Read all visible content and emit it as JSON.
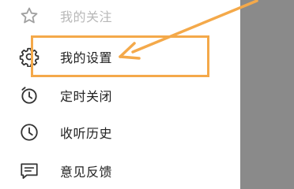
{
  "menu": {
    "items": [
      {
        "label": "我的关注",
        "icon": "star-icon"
      },
      {
        "label": "我的设置",
        "icon": "gear-icon"
      },
      {
        "label": "定时关闭",
        "icon": "alarm-clock-icon"
      },
      {
        "label": "收听历史",
        "icon": "clock-icon"
      },
      {
        "label": "意见反馈",
        "icon": "message-icon"
      }
    ]
  },
  "annotation": {
    "highlight_color": "#f4a94a",
    "highlighted_item": "我的设置"
  },
  "colors": {
    "text": "#222222",
    "faded_text": "#b8b8b8",
    "backdrop": "#8a8a8a"
  }
}
